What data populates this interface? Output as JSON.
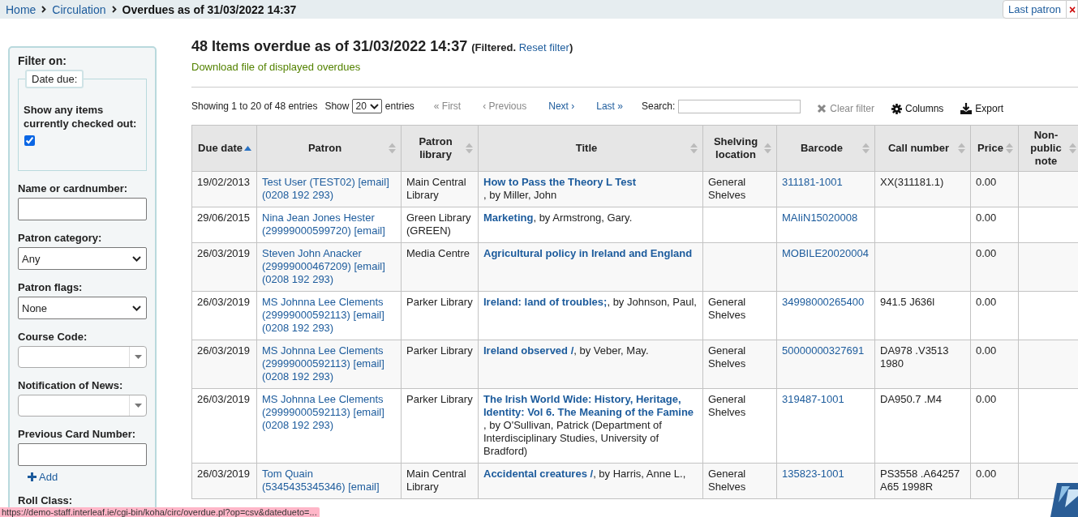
{
  "breadcrumb": [
    {
      "label": "Home",
      "current": false
    },
    {
      "label": "Circulation",
      "current": false
    },
    {
      "label": "Overdues as of 31/03/2022 14:37",
      "current": true
    }
  ],
  "header_buttons": {
    "last_patron": "Last patron",
    "close": "×"
  },
  "sidebar": {
    "title": "Filter on:",
    "date_due": {
      "legend": "Date due:",
      "checkbox_label": "Show any items currently checked out:",
      "checked": true
    },
    "fields": [
      {
        "kind": "text",
        "label": "Name or cardnumber:"
      },
      {
        "kind": "select",
        "label": "Patron category:",
        "value": "Any"
      },
      {
        "kind": "select",
        "label": "Patron flags:",
        "value": "None"
      },
      {
        "kind": "combo",
        "label": "Course Code:"
      },
      {
        "kind": "combo",
        "label": "Notification of News:"
      },
      {
        "kind": "text",
        "label": "Previous Card Number:"
      }
    ],
    "add_link": "Add",
    "next_label": "Roll Class:"
  },
  "heading": "48 Items overdue as of 31/03/2022 14:37",
  "filter_note": {
    "before": "(Filtered.",
    "link": "Reset filter",
    "after": ")"
  },
  "download_link": "Download file of displayed overdues",
  "toolbar": {
    "info": "Showing 1 to 20 of 48 entries",
    "show_label": "Show",
    "page_length": "20",
    "entries_label": "entries",
    "paging": [
      {
        "label": "« First",
        "disabled": true
      },
      {
        "label": "‹ Previous",
        "disabled": true
      },
      {
        "label": "Next ›",
        "disabled": false
      },
      {
        "label": "Last »",
        "disabled": false
      }
    ],
    "search_label": "Search:",
    "buttons": [
      {
        "kind": "clear",
        "label": "Clear filter",
        "disabled": true
      },
      {
        "kind": "columns",
        "label": "Columns",
        "disabled": false
      },
      {
        "kind": "export",
        "label": "Export",
        "disabled": false
      }
    ]
  },
  "columns": [
    {
      "label": "Due date",
      "sorted": true
    },
    {
      "label": "Patron",
      "sorted": false
    },
    {
      "label": "Patron library",
      "sorted": false
    },
    {
      "label": "Title",
      "sorted": false
    },
    {
      "label": "Shelving location",
      "sorted": false
    },
    {
      "label": "Barcode",
      "sorted": false
    },
    {
      "label": "Call number",
      "sorted": false
    },
    {
      "label": "Price",
      "sorted": false
    },
    {
      "label": "Non-public note",
      "sorted": false
    }
  ],
  "rows": [
    {
      "due": "19/02/2013",
      "patron": "Test User (TEST02) [email] (0208 192 293)",
      "library": "Main Central Library",
      "title": "How to Pass the Theory L Test",
      "author": ", by Miller, John",
      "location": "General Shelves",
      "barcode": "311181-1001",
      "call_number": "XX(311181.1)",
      "price": "0.00"
    },
    {
      "due": "29/06/2015",
      "patron": "Nina Jean Jones Hester (29999000599720) [email]",
      "library": "Green Library (GREEN)",
      "title": "Marketing",
      "author": ", by Armstrong, Gary.",
      "location": "",
      "barcode": "MAIiN15020008",
      "call_number": "",
      "price": "0.00"
    },
    {
      "due": "26/03/2019",
      "patron": "Steven John Anacker (29999000467209) [email] (0208 192 293)",
      "library": "Media Centre",
      "title": "Agricultural policy in Ireland and England",
      "author": "",
      "location": "",
      "barcode": "MOBILE20020004",
      "call_number": "",
      "price": "0.00"
    },
    {
      "due": "26/03/2019",
      "patron": "MS Johnna Lee Clements (29999000592113) [email] (0208 192 293)",
      "library": "Parker Library",
      "title": "Ireland: land of troubles;",
      "author": ", by Johnson, Paul,",
      "location": "General Shelves",
      "barcode": "34998000265400",
      "call_number": "941.5 J636l",
      "price": "0.00"
    },
    {
      "due": "26/03/2019",
      "patron": "MS Johnna Lee Clements (29999000592113) [email] (0208 192 293)",
      "library": "Parker Library",
      "title": "Ireland observed /",
      "author": ", by Veber, May.",
      "location": "General Shelves",
      "barcode": "50000000327691",
      "call_number": "DA978 .V3513 1980",
      "price": "0.00"
    },
    {
      "due": "26/03/2019",
      "patron": "MS Johnna Lee Clements (29999000592113) [email] (0208 192 293)",
      "library": "Parker Library",
      "title": "The Irish World Wide: History, Heritage, Identity: Vol 6. The Meaning of the Famine",
      "author": ", by O'Sullivan, Patrick (Department of Interdisciplinary Studies, University of Bradford)",
      "location": "General Shelves",
      "barcode": "319487-1001",
      "call_number": "DA950.7 .M4",
      "price": "0.00"
    },
    {
      "due": "26/03/2019",
      "patron": "Tom Quain (5345435345346) [email]",
      "library": "Main Central Library",
      "title": "Accidental creatures /",
      "author": ", by Harris, Anne L.,",
      "location": "General Shelves",
      "barcode": "135823-1001",
      "call_number": "PS3558 .A64257 A65 1998R",
      "price": "0.00"
    }
  ],
  "status_bar": "https://demo-staff.interleaf.ie/cgi-bin/koha/circ/overdue.pl?op=csv&datedueto=..."
}
